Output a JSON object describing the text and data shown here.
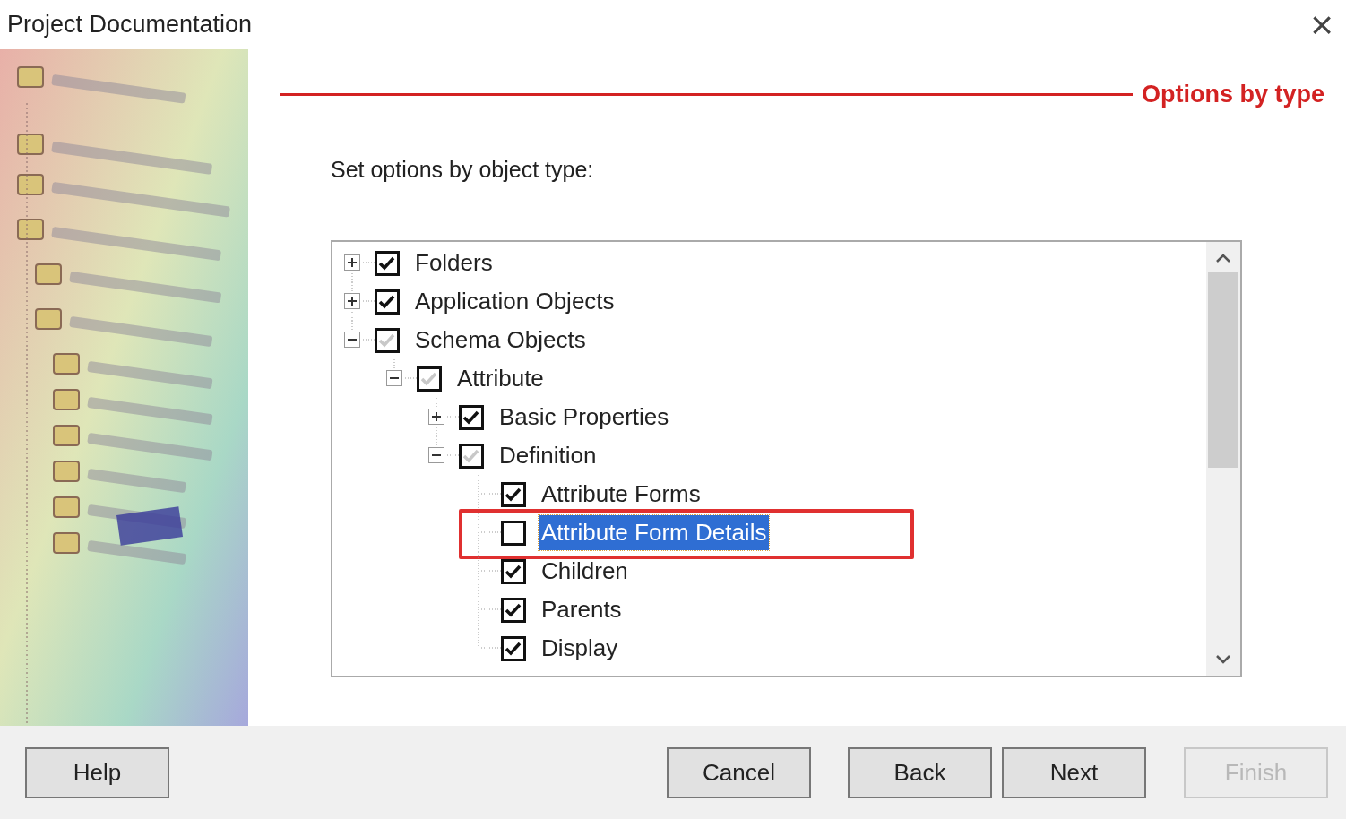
{
  "window": {
    "title": "Project Documentation",
    "close": "×"
  },
  "section": {
    "title": "Options by type",
    "prompt": "Set options by object type:"
  },
  "tree": [
    {
      "label": "Folders",
      "checked": true,
      "partial": false,
      "expanded": false,
      "has_children": true,
      "selected": false,
      "highlighted": false
    },
    {
      "label": "Application Objects",
      "checked": true,
      "partial": false,
      "expanded": false,
      "has_children": true,
      "selected": false,
      "highlighted": false
    },
    {
      "label": "Schema Objects",
      "checked": true,
      "partial": true,
      "expanded": true,
      "has_children": true,
      "selected": false,
      "highlighted": false,
      "children": [
        {
          "label": "Attribute",
          "checked": true,
          "partial": true,
          "expanded": true,
          "has_children": true,
          "selected": false,
          "highlighted": false,
          "children": [
            {
              "label": "Basic Properties",
              "checked": true,
              "partial": false,
              "expanded": false,
              "has_children": true,
              "selected": false,
              "highlighted": false
            },
            {
              "label": "Definition",
              "checked": true,
              "partial": true,
              "expanded": true,
              "has_children": true,
              "selected": false,
              "highlighted": false,
              "children": [
                {
                  "label": "Attribute Forms",
                  "checked": true,
                  "partial": false,
                  "has_children": false,
                  "selected": false,
                  "highlighted": false
                },
                {
                  "label": "Attribute Form Details",
                  "checked": false,
                  "partial": false,
                  "has_children": false,
                  "selected": true,
                  "highlighted": true
                },
                {
                  "label": "Children",
                  "checked": true,
                  "partial": false,
                  "has_children": false,
                  "selected": false,
                  "highlighted": false
                },
                {
                  "label": "Parents",
                  "checked": true,
                  "partial": false,
                  "has_children": false,
                  "selected": false,
                  "highlighted": false
                },
                {
                  "label": "Display",
                  "checked": true,
                  "partial": false,
                  "has_children": false,
                  "selected": false,
                  "highlighted": false
                }
              ]
            }
          ]
        }
      ]
    }
  ],
  "buttons": [
    {
      "label": "Help",
      "disabled": false
    },
    {
      "label": "Cancel",
      "disabled": false
    },
    {
      "label": "Back",
      "disabled": false
    },
    {
      "label": "Next",
      "disabled": false
    },
    {
      "label": "Finish",
      "disabled": true
    }
  ]
}
